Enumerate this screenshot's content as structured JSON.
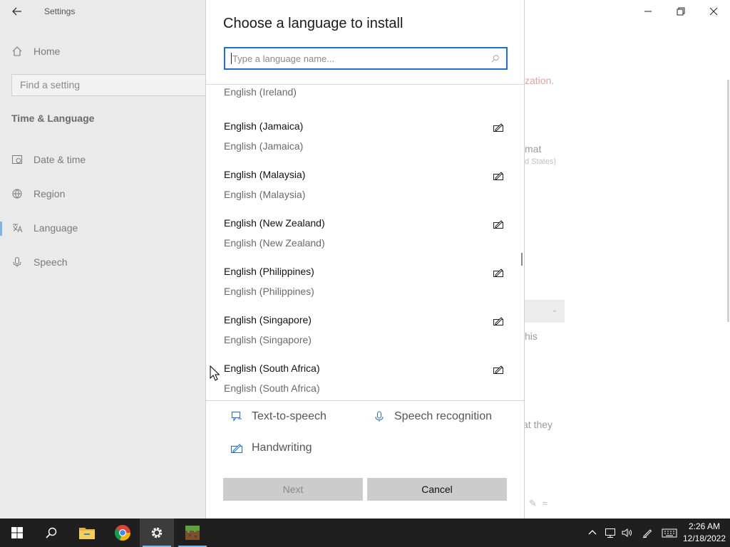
{
  "settings": {
    "window_title": "Settings",
    "home_label": "Home",
    "search_placeholder": "Find a setting",
    "section_title": "Time & Language",
    "nav": [
      {
        "label": "Date & time",
        "icon": "clock-icon"
      },
      {
        "label": "Region",
        "icon": "globe-icon"
      },
      {
        "label": "Language",
        "icon": "language-icon"
      },
      {
        "label": "Speech",
        "icon": "microphone-icon"
      }
    ],
    "active_nav": "Language",
    "background_fragments": {
      "warning": "zation.",
      "format": "mat",
      "region_small": "d States)",
      "this": "his",
      "they": "at they"
    }
  },
  "dialog": {
    "title": "Choose a language to install",
    "search_placeholder": "Type a language name...",
    "partial_item": "English (Ireland)",
    "languages": [
      {
        "name": "English (Jamaica)",
        "native": "English (Jamaica)",
        "icon": "handwriting-icon"
      },
      {
        "name": "English (Malaysia)",
        "native": "English (Malaysia)",
        "icon": "handwriting-icon"
      },
      {
        "name": "English (New Zealand)",
        "native": "English (New Zealand)",
        "icon": "handwriting-icon"
      },
      {
        "name": "English (Philippines)",
        "native": "English (Philippines)",
        "icon": "handwriting-icon"
      },
      {
        "name": "English (Singapore)",
        "native": "English (Singapore)",
        "icon": "handwriting-icon"
      },
      {
        "name": "English (South Africa)",
        "native": "English (South Africa)",
        "icon": "handwriting-icon"
      }
    ],
    "legend": {
      "tts": "Text-to-speech",
      "speech_recognition": "Speech recognition",
      "handwriting": "Handwriting"
    },
    "buttons": {
      "next": "Next",
      "cancel": "Cancel"
    }
  },
  "taskbar": {
    "apps": [
      "start-icon",
      "search-icon",
      "file-explorer-icon",
      "chrome-icon",
      "settings-icon",
      "minecraft-icon"
    ],
    "clock_time": "2:26 AM",
    "clock_date": "12/18/2022"
  },
  "colors": {
    "accent": "#1f6fc5",
    "taskbar": "#1f1f1f",
    "sidebar": "#eaeaea"
  }
}
